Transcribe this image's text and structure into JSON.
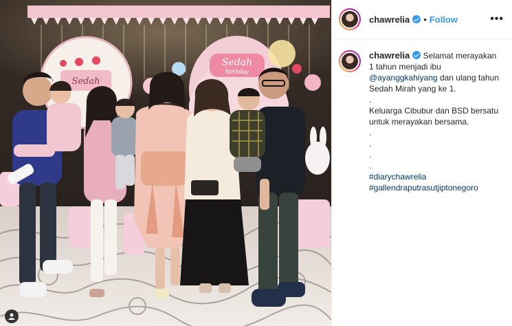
{
  "post": {
    "username": "chawrelia",
    "follow_label": "Follow",
    "separator": "•",
    "more_icon": "•••"
  },
  "caption": {
    "username": "chawrelia",
    "text_intro": "Selamat merayakan 1 tahun menjadi ibu",
    "mention": "@ayanggkahiyang",
    "text_after": "dan ulang tahun Sedah Mirah yang ke 1.",
    "dot1": ".",
    "line2": "Keluarga Cibubur dan BSD bersatu untuk merayakan bersama.",
    "dot2": ".",
    "dot3": ".",
    "dot4": ".",
    "dot5": ".",
    "hashtag1": "#diarychawrelia",
    "hashtag2": "#gallendraputrasutjiptonegoro"
  },
  "photo": {
    "backdrop_sign_line1": "Sedah",
    "backdrop_sign_line2": "Birthday",
    "left_sign": "Sedah"
  },
  "colors": {
    "link": "#003569",
    "follow": "#3897f0",
    "verified": "#3897f0"
  }
}
